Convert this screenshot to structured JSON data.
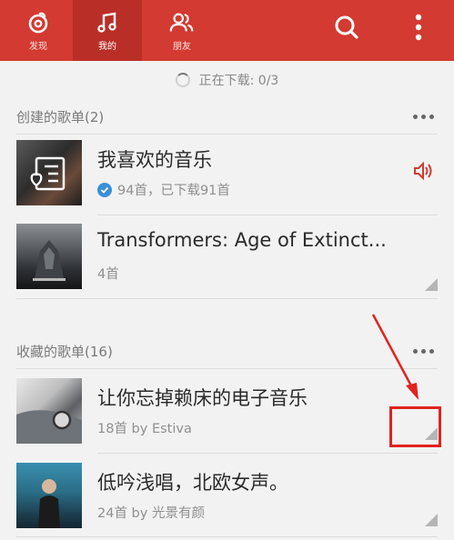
{
  "tabs": [
    {
      "label": "发现",
      "icon": "netease-music-logo-icon"
    },
    {
      "label": "我的",
      "icon": "music-note-icon"
    },
    {
      "label": "朋友",
      "icon": "friends-icon"
    }
  ],
  "actions": {
    "search_icon": "search-icon",
    "menu_icon": "more-vertical-icon"
  },
  "download_status": "正在下载: 0/3",
  "created": {
    "header": "创建的歌单(2)",
    "items": [
      {
        "title": "我喜欢的音乐",
        "subtitle": "94首，已下载91首",
        "verified": true,
        "playing": true
      },
      {
        "title": "Transformers: Age of Extinct...",
        "subtitle": "4首"
      }
    ]
  },
  "collected": {
    "header": "收藏的歌单(16)",
    "items": [
      {
        "title": "让你忘掉赖床的电子音乐",
        "subtitle": "18首 by Estiva"
      },
      {
        "title": "低吟浅唱，北欧女声。",
        "subtitle": "24首 by 光景有颜"
      }
    ]
  },
  "colors": {
    "brand": "#d33a31",
    "annotation": "#e0231e",
    "check": "#3a8fd6"
  }
}
